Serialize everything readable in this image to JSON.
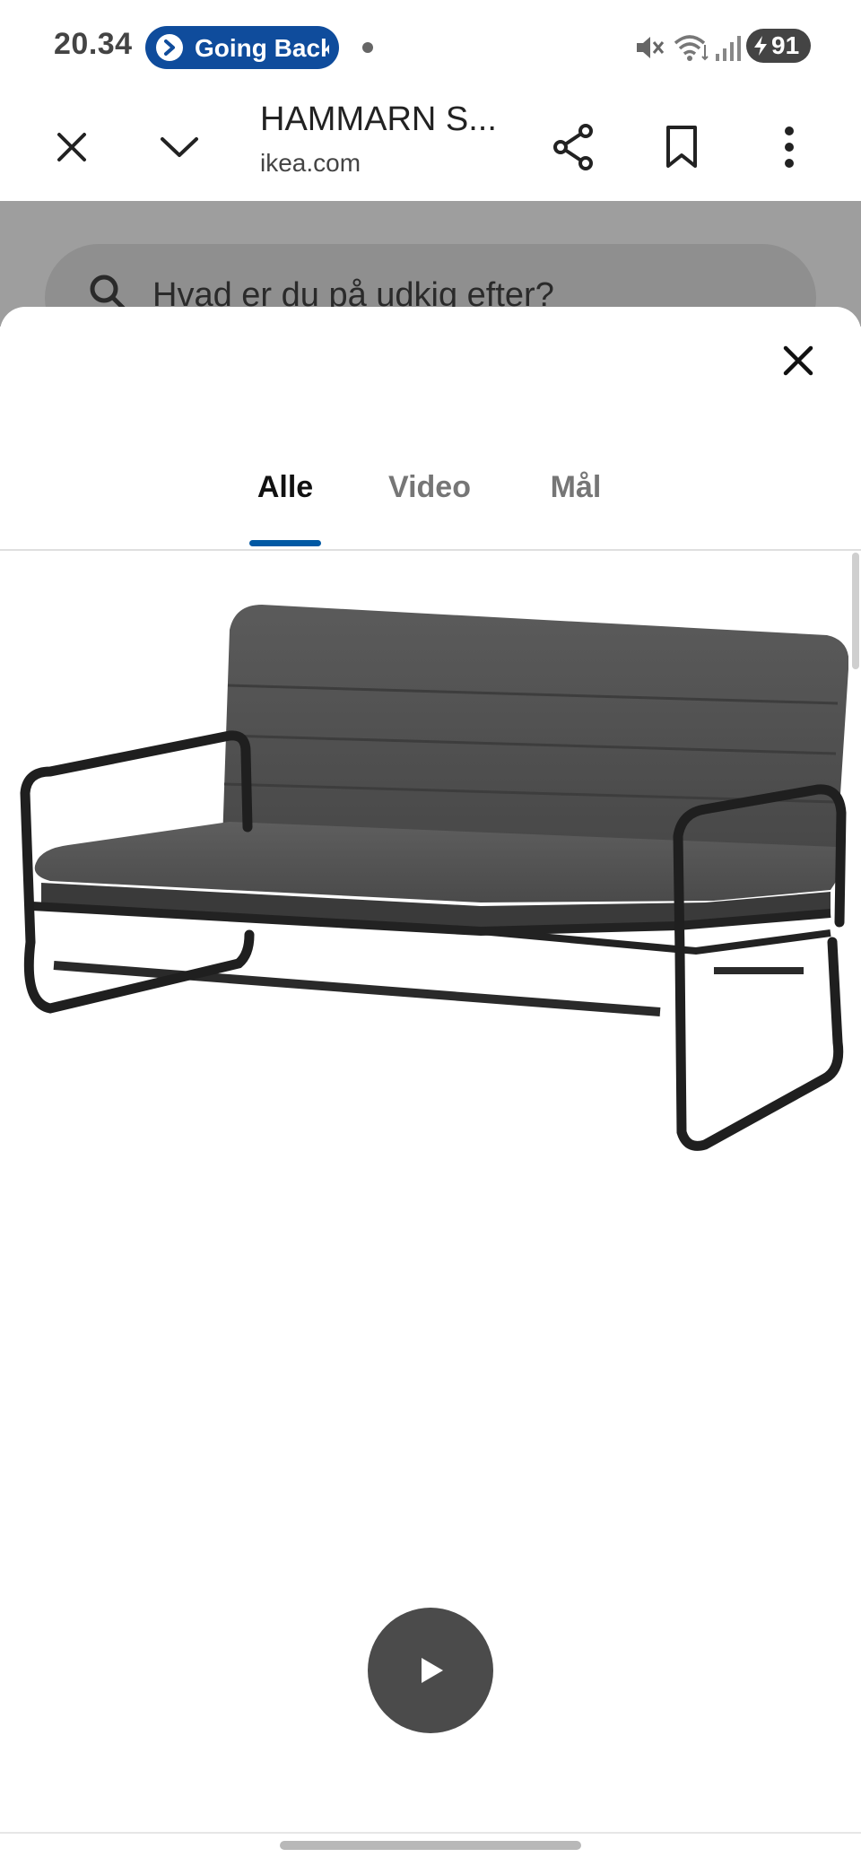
{
  "status_bar": {
    "time": "20.34",
    "pill_text": "Going Back",
    "battery": "91"
  },
  "browser": {
    "title": "HAMMARN S...",
    "domain": "ikea.com"
  },
  "background_page": {
    "search_placeholder": "Hvad er du på udkig efter?"
  },
  "gallery": {
    "tabs": [
      {
        "label": "Alle",
        "active": true
      },
      {
        "label": "Video",
        "active": false
      },
      {
        "label": "Mål",
        "active": false
      }
    ]
  },
  "colors": {
    "accent": "#0058a3",
    "pill": "#0f4c9c",
    "play_button": "#4b4b4b"
  }
}
